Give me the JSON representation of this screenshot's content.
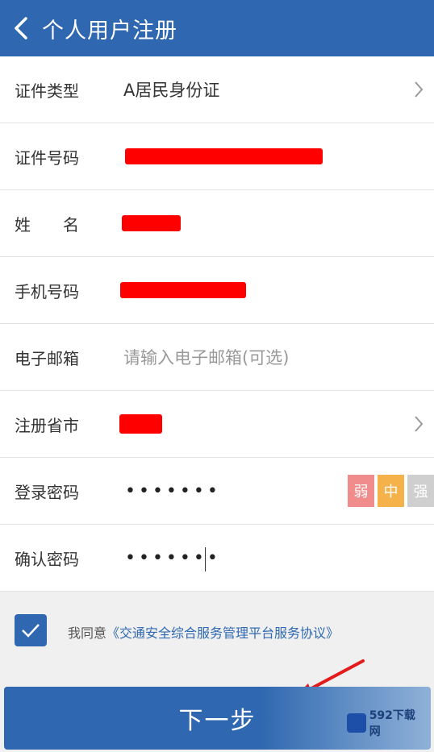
{
  "header": {
    "title": "个人用户注册"
  },
  "form": {
    "id_type": {
      "label": "证件类型",
      "value": "A居民身份证"
    },
    "id_number": {
      "label": "证件号码"
    },
    "name": {
      "label": "姓　　名"
    },
    "phone": {
      "label": "手机号码"
    },
    "email": {
      "label": "电子邮箱",
      "placeholder": "请输入电子邮箱(可选)"
    },
    "region": {
      "label": "注册省市"
    },
    "password": {
      "label": "登录密码",
      "value": "•••••••"
    },
    "confirm_password": {
      "label": "确认密码",
      "value": "•••••••"
    },
    "strength": {
      "weak": "弱",
      "medium": "中",
      "strong": "强"
    }
  },
  "agreement": {
    "prefix": "我同意",
    "link": "《交通安全综合服务管理平台服务协议》",
    "checked": true
  },
  "next_button": {
    "label": "下一步"
  },
  "watermark": {
    "text": "592下载网"
  },
  "colors": {
    "primary": "#2f68b0",
    "weak": "#f08c8c",
    "medium": "#f5b24a",
    "strong": "#cfcfcf",
    "redact": "#ff0000"
  }
}
